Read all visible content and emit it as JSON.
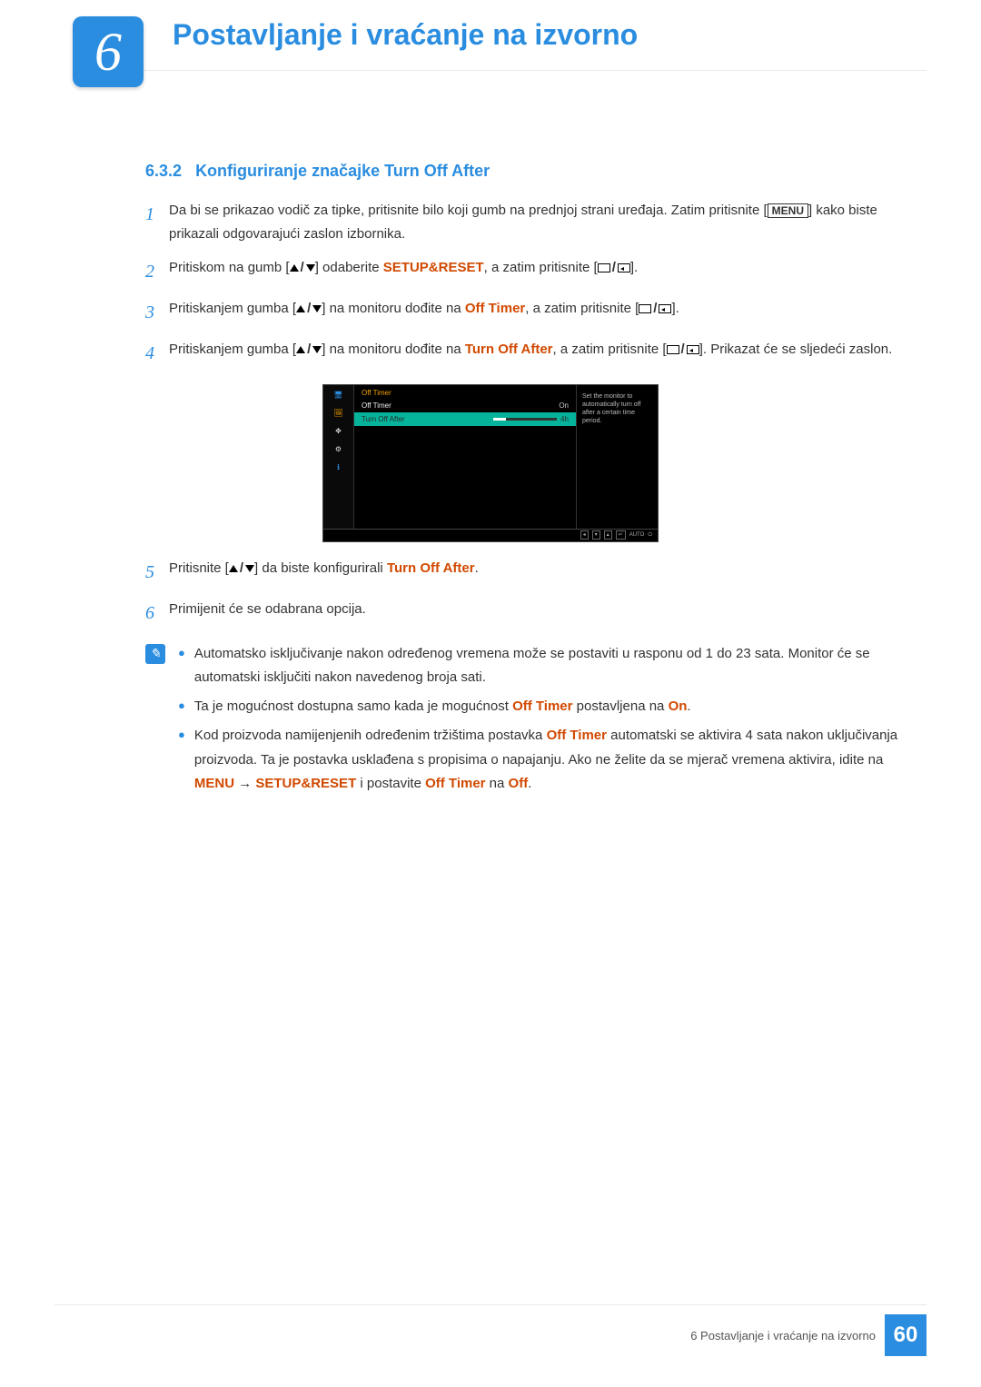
{
  "header": {
    "chapter_number": "6",
    "chapter_title": "Postavljanje i vraćanje na izvorno"
  },
  "section": {
    "number": "6.3.2",
    "title": "Konfiguriranje značajke Turn Off After"
  },
  "steps": [
    {
      "num": "1",
      "pre": "Da bi se prikazao vodič za tipke, pritisnite bilo koji gumb na prednjoj strani uređaja. Zatim pritisnite [",
      "menu_label": "MENU",
      "post": "] kako biste prikazali odgovarajući zaslon izbornika."
    },
    {
      "num": "2",
      "pre": "Pritiskom na gumb [",
      "mid1": "] odaberite ",
      "hl": "SETUP&RESET",
      "mid2": ", a zatim pritisnite [",
      "post": "]."
    },
    {
      "num": "3",
      "pre": "Pritiskanjem gumba [",
      "mid1": "] na monitoru dođite na ",
      "hl": "Off Timer",
      "mid2": ", a zatim pritisnite [",
      "post": "]."
    },
    {
      "num": "4",
      "pre": "Pritiskanjem gumba [",
      "mid1": "] na monitoru dođite na ",
      "hl": "Turn Off After",
      "mid2": ", a zatim pritisnite [",
      "post": "]. Prikazat će se sljedeći zaslon."
    },
    {
      "num": "5",
      "pre": "Pritisnite [",
      "mid1": "] da biste konfigurirali ",
      "hl": "Turn Off After",
      "post": "."
    },
    {
      "num": "6",
      "text": "Primijenit će se odabrana opcija."
    }
  ],
  "osd": {
    "header": "Off Timer",
    "rows": [
      {
        "label": "Off Timer",
        "value": "On",
        "selected": false
      },
      {
        "label": "Turn Off After",
        "value": "4h",
        "selected": true
      }
    ],
    "desc": "Set the monitor to automatically turn off after a certain time period.",
    "bottom_buttons": [
      "◂",
      "▾",
      "▴",
      "↵"
    ],
    "bottom_auto": "AUTO",
    "bottom_power": "⏻"
  },
  "notes": [
    {
      "parts": [
        {
          "t": "Automatsko isključivanje nakon određenog vremena može se postaviti u rasponu od 1 do 23 sata. Monitor će se automatski isključiti nakon navedenog broja sati."
        }
      ]
    },
    {
      "parts": [
        {
          "t": "Ta je mogućnost dostupna samo kada je mogućnost "
        },
        {
          "t": "Off Timer",
          "hl": true
        },
        {
          "t": " postavljena na "
        },
        {
          "t": "On",
          "hl": true
        },
        {
          "t": "."
        }
      ]
    },
    {
      "parts": [
        {
          "t": "Kod proizvoda namijenjenih određenim tržištima postavka "
        },
        {
          "t": "Off Timer",
          "hl": true
        },
        {
          "t": " automatski se aktivira 4 sata nakon uključivanja proizvoda. Ta je postavka usklađena s propisima o napajanju. Ako ne želite da se mjerač vremena aktivira, idite na "
        },
        {
          "t": "MENU",
          "hl": true
        },
        {
          "t": "  →  "
        },
        {
          "t": "SETUP&RESET",
          "hl": true
        },
        {
          "t": " i postavite "
        },
        {
          "t": "Off Timer",
          "hl": true
        },
        {
          "t": " na "
        },
        {
          "t": "Off",
          "hl": true
        },
        {
          "t": "."
        }
      ]
    }
  ],
  "footer": {
    "text": "6 Postavljanje i vraćanje na izvorno",
    "page": "60"
  },
  "icons": {
    "monitor": "🖥",
    "picture": "🖼",
    "move": "✥",
    "gear": "⚙",
    "info": "ℹ"
  }
}
